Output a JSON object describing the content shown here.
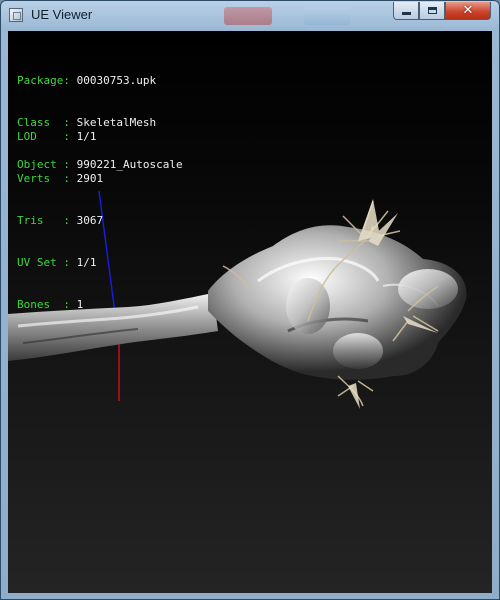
{
  "window": {
    "title": "UE Viewer"
  },
  "title_controls": {
    "minimize_icon": "minimize-icon",
    "maximize_icon": "maximize-icon",
    "close_icon": "close-icon",
    "close_glyph": "✕"
  },
  "object_info": [
    {
      "label": "Package",
      "value": "00030753.upk"
    },
    {
      "label": "Class  ",
      "value": "SkeletalMesh"
    },
    {
      "label": "Object ",
      "value": "990221_Autoscale"
    }
  ],
  "mesh_info": [
    {
      "label": "LOD    ",
      "value": "1/1"
    },
    {
      "label": "Verts  ",
      "value": "2901"
    },
    {
      "label": "Tris   ",
      "value": "3067"
    },
    {
      "label": "UV Set ",
      "value": "1/1"
    },
    {
      "label": "Bones  ",
      "value": "1"
    }
  ],
  "colors": {
    "label_green": "#3ed83e",
    "value_white": "#f0f0f0",
    "axis_x": "#c81010",
    "axis_y": "#1a1ad8"
  }
}
